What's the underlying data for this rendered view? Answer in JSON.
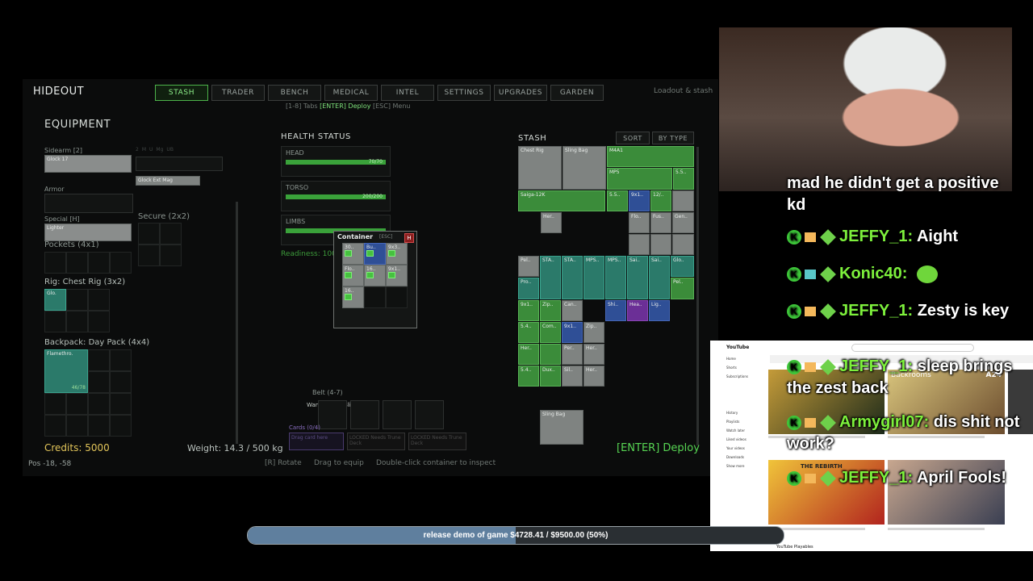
{
  "game": {
    "title": "HIDEOUT",
    "tabs": [
      "STASH",
      "TRADER",
      "BENCH",
      "MEDICAL",
      "INTEL",
      "SETTINGS",
      "UPGRADES",
      "GARDEN"
    ],
    "active_tab": "STASH",
    "top_right": "Loadout & stash",
    "hint": {
      "pre": "[1-8] Tabs",
      "hl": "[ENTER] Deploy",
      "post": "[ESC] Menu"
    },
    "equipment": {
      "title": "EQUIPMENT",
      "sidearm_label": "Sidearm [2]",
      "sidearm_item": "Glock 17",
      "mag_labels": [
        "2",
        "M",
        "U",
        "Mg",
        "UB"
      ],
      "mag_item": "Glock Ext Mag",
      "armor_label": "Armor",
      "special_label": "Special [H]",
      "special_item": "Lighter",
      "secure_label": "Secure (2x2)",
      "pockets_label": "Pockets (4x1)",
      "rig_label": "Rig: Chest Rig (3x2)",
      "rig_item": "Glo.",
      "backpack_label": "Backpack: Day Pack (4x4)",
      "backpack_item": "Flamethro.",
      "backpack_item_count": "46/78"
    },
    "health": {
      "title": "HEALTH STATUS",
      "parts": [
        {
          "label": "HEAD",
          "value": "70/70",
          "fill": 1.0
        },
        {
          "label": "TORSO",
          "value": "200/200",
          "fill": 1.0
        },
        {
          "label": "LIMBS",
          "value": "",
          "fill": 1.0
        }
      ],
      "readiness": "Readiness: 100"
    },
    "container": {
      "title": "Container",
      "esc": "[ESC]",
      "close": "H",
      "items": [
        "30..",
        "Bu..",
        "9x3..",
        "Flo..",
        "16..",
        "9x1..",
        "16.."
      ]
    },
    "stash": {
      "title": "STASH",
      "sort": "SORT",
      "by_type": "BY TYPE",
      "labels": [
        "Chest Rig",
        "Sling Bag",
        "M4A1",
        "MP5",
        "5.5..",
        "Saiga-12K",
        "5.5..",
        "9x1..",
        "12/..",
        "Her..",
        "Flo..",
        "Fus..",
        "Gen..",
        "Pel..",
        "STA..",
        "STA..",
        "MPS..",
        "MPS..",
        "Sai..",
        "Sai..",
        "Glo..",
        "Pro..",
        "Pel..",
        "9x1..",
        "Zip..",
        "Can..",
        "Shi..",
        "Hea..",
        "Lig..",
        "5.4..",
        "Com..",
        "9x1..",
        "Zip..",
        "Her..",
        "Per..",
        "Her..",
        "5.4..",
        "Dux..",
        "Sil..",
        "Her..",
        "Sling Bag"
      ]
    },
    "belt": {
      "label": "Belt (4-7)",
      "items": [
        "Wand of Fire",
        "Blink Stone"
      ]
    },
    "cards": {
      "label": "Cards (0/4)",
      "drag": "Drag card here",
      "locked1": "LOCKED Needs Trune Deck",
      "locked2": "LOCKED Needs Trune Deck"
    },
    "credits": "Credits: 5000",
    "weight": "Weight: 14.3 / 500 kg",
    "deploy": "[ENTER] Deploy",
    "pos": "Pos -18, -58",
    "footer_hints": [
      "[R] Rotate",
      "Drag to equip",
      "Double-click container to inspect"
    ]
  },
  "chat": [
    {
      "name": "",
      "text": "mad he didn't get a positive kd"
    },
    {
      "name": "JEFFY_1:",
      "text": "Aight"
    },
    {
      "name": "Konic40:",
      "text": ""
    },
    {
      "name": "JEFFY_1:",
      "text": "Zesty is key"
    },
    {
      "name": "JEFFY_1:",
      "text": "sleep brings the zest back"
    },
    {
      "name": "Armygirl07:",
      "text": "dis shit not work?"
    },
    {
      "name": "JEFFY_1:",
      "text": "April Fools!"
    }
  ],
  "youtube": {
    "logo": "YouTube",
    "sidebar": [
      "Home",
      "Shorts",
      "Subscriptions",
      "History",
      "Playlists",
      "Watch later",
      "Liked videos",
      "Your videos",
      "Downloads",
      "Show more"
    ],
    "thumb_labels": [
      "Backrooms",
      "A24",
      "THE REBIRTH"
    ],
    "footer": "YouTube Playables"
  },
  "goal": {
    "text": "release demo of game $4728.41 / $9500.00 (50%)",
    "progress": 0.5
  }
}
